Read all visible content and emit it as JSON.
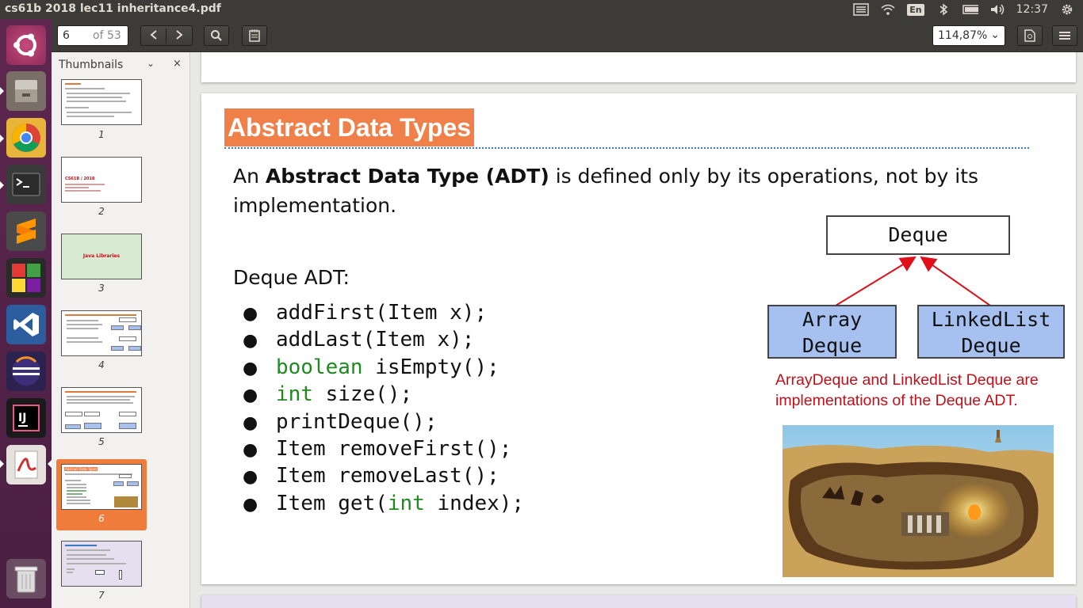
{
  "window": {
    "title": "cs61b 2018 lec11 inheritance4.pdf"
  },
  "tray": {
    "keyboard": "En",
    "time": "12:37"
  },
  "toolbar": {
    "current_page": "6",
    "page_total": "of 53",
    "zoom": "114,87%"
  },
  "sidebar": {
    "header": "Thumbnails",
    "thumbnails": [
      {
        "num": "1",
        "title": ""
      },
      {
        "num": "2",
        "title": "CS61B / 2018"
      },
      {
        "num": "3",
        "title": "Java Libraries"
      },
      {
        "num": "4",
        "title": ""
      },
      {
        "num": "5",
        "title": ""
      },
      {
        "num": "6",
        "title": "Abstract Data Types"
      },
      {
        "num": "7",
        "title": ""
      }
    ]
  },
  "slide": {
    "title": "Abstract Data Types",
    "intro_pre": "An ",
    "intro_bold": "Abstract Data Type (ADT)",
    "intro_post": " is defined only by its operations, not by its implementation.",
    "deque_label": "Deque ADT:",
    "bullet": "●",
    "methods": [
      {
        "kw": "",
        "text": "addFirst(Item x);"
      },
      {
        "kw": "",
        "text": "addLast(Item x);"
      },
      {
        "kw": "boolean",
        "text": " isEmpty();"
      },
      {
        "kw": "int",
        "text": " size();"
      },
      {
        "kw": "",
        "text": "printDeque();"
      },
      {
        "kw": "",
        "text": "Item removeFirst();"
      },
      {
        "kw": "",
        "text": "Item removeLast();"
      },
      {
        "kw": "",
        "text": "Item get(",
        "kw2": "int",
        "text2": " index);"
      }
    ],
    "diagram": {
      "parent": "Deque",
      "child1_line1": "Array",
      "child1_line2": "Deque",
      "child2_line1": "LinkedList",
      "child2_line2": "Deque"
    },
    "caption": "ArrayDeque and LinkedList Deque are implementations of the Deque ADT."
  },
  "colors": {
    "title_bg": "#f0804a",
    "keyword": "#1f8a1f",
    "caption": "#c0101a",
    "box_fill": "#a6c0f0",
    "arrow": "#e0101a"
  },
  "icons": [
    "ubuntu-dash-icon",
    "files-icon",
    "chrome-icon",
    "terminal-icon",
    "sublime-icon",
    "apps-icon",
    "vscode-icon",
    "eclipse-icon",
    "intellij-icon",
    "pdf-viewer-icon",
    "trash-icon"
  ]
}
